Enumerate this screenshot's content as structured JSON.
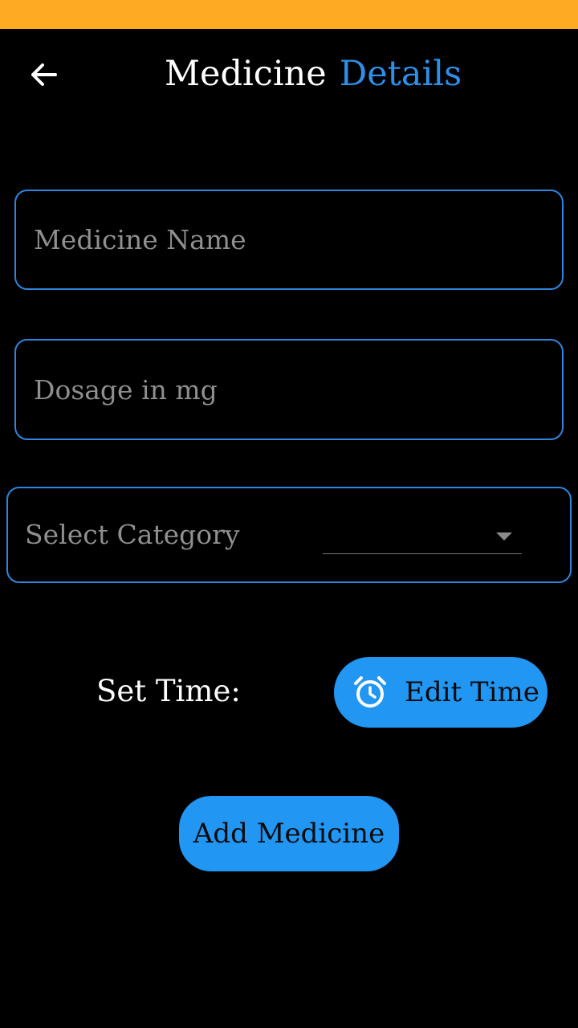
{
  "header": {
    "title_part1": "Medicine",
    "title_part2": "Details"
  },
  "form": {
    "medicine_name": {
      "placeholder": "Medicine Name",
      "value": ""
    },
    "dosage": {
      "placeholder": "Dosage in mg",
      "value": ""
    },
    "category": {
      "label": "Select Category",
      "selected": ""
    }
  },
  "time": {
    "label": "Set Time:",
    "button_label": "Edit Time"
  },
  "actions": {
    "add_label": "Add Medicine"
  },
  "icons": {
    "back": "arrow-back-icon",
    "alarm": "alarm-clock-icon",
    "dropdown": "caret-down-icon"
  },
  "colors": {
    "status_bar": "#FFAA22",
    "accent": "#2196F3",
    "field_border": "#2E86DE",
    "title_accent": "#2E8FE8",
    "background": "#000000"
  }
}
